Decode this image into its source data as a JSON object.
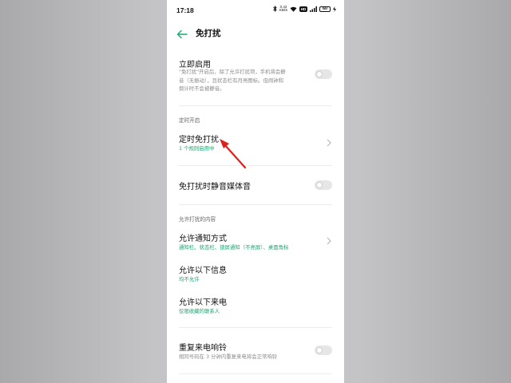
{
  "status_bar": {
    "time": "17:18",
    "icons": [
      "bluetooth-icon",
      "network-speed-icon",
      "wifi-icon",
      "hd-icon",
      "signal-icon",
      "battery-icon",
      "charging-icon"
    ],
    "network_speed": "0.42 KB/S",
    "hd_label": "HD",
    "battery_level": "60"
  },
  "header": {
    "title": "免打扰"
  },
  "immediate": {
    "title": "立即启用",
    "desc_lines": [
      "\"免打扰\"开启后，除了允许打扰项，手机将会静",
      "音（无振动），且状态栏有月亮图标。但闹钟和",
      "倒计时不会被静音。"
    ],
    "enabled": false
  },
  "scheduled_section": {
    "label": "定时开启"
  },
  "scheduled": {
    "title": "定时免打扰",
    "subtitle": "1 个规则启用中"
  },
  "mute_media": {
    "title": "免打扰时静音媒体音",
    "enabled": false
  },
  "allow_section": {
    "label": "允许打扰的内容"
  },
  "notify_method": {
    "title": "允许通知方式",
    "subtitle": "通知栏、状态栏、锁屏通知（不亮屏）、桌面角标"
  },
  "messages": {
    "title": "允许以下信息",
    "subtitle": "均不允许"
  },
  "calls": {
    "title": "允许以下来电",
    "subtitle": "仅限收藏的联系人"
  },
  "repeat_calls": {
    "title": "重复来电响铃",
    "subtitle": "相同号码在 3 分钟内重复来电将会正常响铃",
    "enabled": false
  },
  "colors": {
    "accent_green": "#1aa870",
    "annotation_red": "#e0201b"
  }
}
